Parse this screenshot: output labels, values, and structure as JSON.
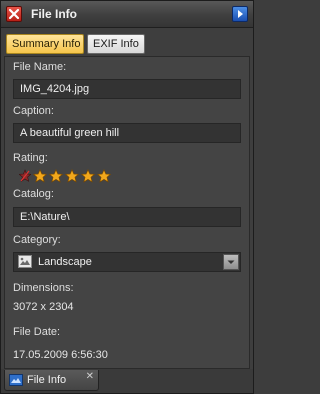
{
  "panel": {
    "title": "File Info",
    "close_icon": "close-x-icon",
    "nav_icon": "arrow-right-icon"
  },
  "tabs": [
    {
      "label": "Summary Info",
      "active": true
    },
    {
      "label": "EXIF Info",
      "active": false
    }
  ],
  "summary": {
    "file_name_label": "File Name:",
    "file_name": "IMG_4204.jpg",
    "caption_label": "Caption:",
    "caption": "A beautiful green hill",
    "rating_label": "Rating:",
    "rating": 5,
    "rating_max": 5,
    "catalog_label": "Catalog:",
    "catalog": "E:\\Nature\\",
    "category_label": "Category:",
    "category": "Landscape",
    "dimensions_label": "Dimensions:",
    "dimensions": "3072 x 2304",
    "file_date_label": "File Date:",
    "file_date": "17.05.2009 6:56:30"
  },
  "dock": {
    "tab_label": "File Info",
    "close_glyph": "✕"
  },
  "colors": {
    "active_tab": "#f6c54c",
    "star": "#f2a81c",
    "close_button": "#c9281d",
    "nav_button": "#2a62c8"
  }
}
